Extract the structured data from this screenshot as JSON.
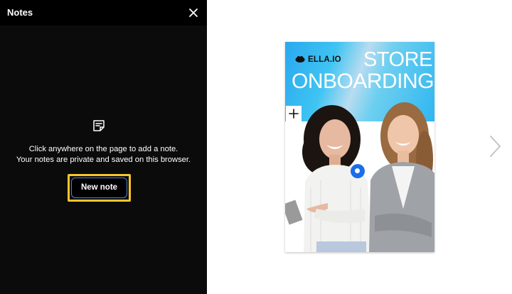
{
  "notes_panel": {
    "title": "Notes",
    "close_icon": "close-icon",
    "note_icon": "note-icon",
    "empty_line1": "Click anywhere on the page to add a note.",
    "empty_line2": "Your notes are private and saved on this browser.",
    "new_note_label": "New note",
    "focus_color": "#f6c62a"
  },
  "preview": {
    "brand": "ELLA.IO",
    "headline_line1": "STORE",
    "headline_line2": "ONBOARDING",
    "add_icon": "plus-icon",
    "marker_icon": "note-marker-icon",
    "next_icon": "chevron-right-icon",
    "banner_color": "#2aa8ef",
    "marker_color": "#1a6fe8"
  }
}
